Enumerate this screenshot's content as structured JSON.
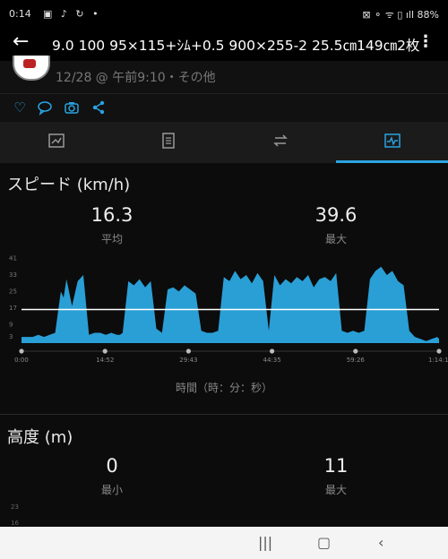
{
  "status_bar": {
    "time": "0:14",
    "left_icons": "▣ ♪ ↻ •",
    "right_icons": "⊠ ⚬ ᯤ ▯ ıll 88%"
  },
  "app_bar": {
    "title": "9.0 100 95×115+ｼﾑ+0.5 900×255-2 25.5㎝149㎝2枚"
  },
  "activity": {
    "date": "12/28 @ 午前9:10・その他"
  },
  "tabs": [
    {
      "icon": "chart-tab-icon",
      "active": false
    },
    {
      "icon": "list-tab-icon",
      "active": false
    },
    {
      "icon": "laps-tab-icon",
      "active": false
    },
    {
      "icon": "graph-tab-icon",
      "active": true
    }
  ],
  "speed": {
    "title": "スピード (km/h)",
    "avg_value": "16.3",
    "avg_label": "平均",
    "max_value": "39.6",
    "max_label": "最大",
    "x_title": "時間（時：分：秒）"
  },
  "altitude": {
    "title": "高度 (m)",
    "min_value": "0",
    "min_label": "最小",
    "max_value": "11",
    "max_label": "最大",
    "y_ticks": [
      "23",
      "16"
    ]
  },
  "chart_data": {
    "type": "area",
    "ytick_labels": [
      "41",
      "33",
      "25",
      "17",
      "9",
      "3"
    ],
    "yticks": [
      41,
      33,
      25,
      17,
      9,
      3
    ],
    "ylim": [
      0,
      43
    ],
    "xticks": [
      "0:00",
      "14:52",
      "29:43",
      "44:35",
      "59:26",
      "1:14:18"
    ],
    "average": 16.3,
    "color": "#2a9fd6",
    "x": [
      0,
      1,
      2,
      3,
      4,
      5,
      6,
      7,
      7.5,
      8,
      9,
      10,
      11,
      12,
      13,
      14,
      15,
      16,
      17,
      17.5,
      18,
      19,
      20,
      21,
      22,
      23,
      24,
      25,
      26,
      27,
      28,
      29,
      30,
      31,
      32,
      33,
      34,
      35,
      36,
      37,
      38,
      39,
      40,
      41,
      42,
      43,
      44,
      45,
      46,
      47,
      48,
      49,
      50,
      51,
      52,
      53,
      54,
      55,
      56,
      57,
      58,
      59,
      60,
      61,
      62,
      63,
      64,
      65,
      66,
      67,
      68,
      69,
      70,
      71,
      72,
      73,
      74,
      74.3
    ],
    "y": [
      3,
      3,
      3,
      4,
      3,
      4,
      5,
      25,
      22,
      31,
      18,
      30,
      33,
      4,
      5,
      5,
      4,
      5,
      4,
      4,
      5,
      30,
      28,
      31,
      27,
      30,
      7,
      5,
      26,
      27,
      25,
      28,
      26,
      24,
      6,
      5,
      5,
      6,
      32,
      30,
      35,
      31,
      33,
      29,
      34,
      30,
      6,
      33,
      28,
      31,
      29,
      32,
      30,
      33,
      27,
      31,
      32,
      30,
      34,
      6,
      5,
      6,
      5,
      6,
      31,
      35,
      37,
      33,
      35,
      30,
      28,
      6,
      3,
      2,
      1,
      2,
      3,
      2,
      0
    ]
  },
  "nav_bar": {
    "recent": "|||",
    "home": "▢",
    "back": "‹"
  }
}
